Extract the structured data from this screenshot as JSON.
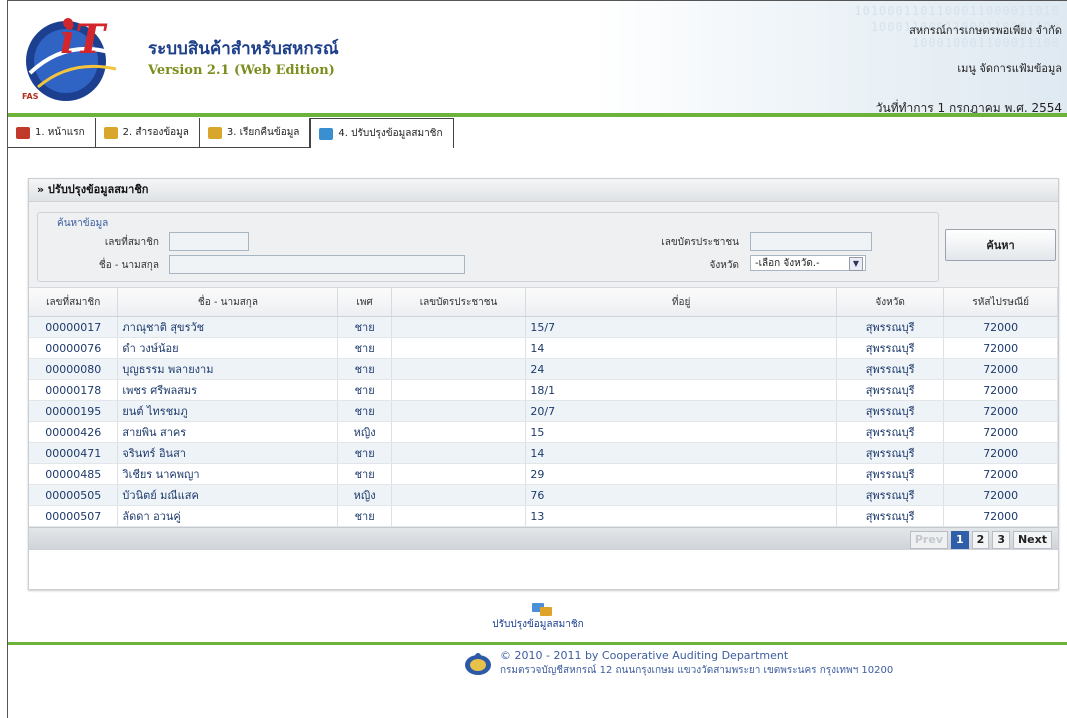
{
  "header": {
    "app_title": "ระบบสินค้าสำหรับสหกรณ์",
    "app_version": "Version 2.1 (Web Edition)",
    "coop_name": "สหกรณ์การเกษตรพอเพียง จำกัด",
    "menu_label": "เมนู จัดการแฟ้มข้อมูล",
    "work_date": "วันที่ทำการ 1 กรกฎาคม พ.ศ. 2554",
    "binary_pattern": [
      "1010001101100011000011010",
      "10001100011000110001100",
      "100010001100011100"
    ]
  },
  "nav": {
    "items": [
      {
        "label": "1. หน้าแรก",
        "icon": "home-icon",
        "color": "#c0392b"
      },
      {
        "label": "2. สำรองข้อมูล",
        "icon": "backup-icon",
        "color": "#d8a62a"
      },
      {
        "label": "3. เรียกคืนข้อมูล",
        "icon": "restore-icon",
        "color": "#d8a62a"
      },
      {
        "label": "4. ปรับปรุงข้อมูลสมาชิก",
        "icon": "update-member-icon",
        "color": "#3a8fd0"
      }
    ]
  },
  "panel": {
    "title": "» ปรับปรุงข้อมูลสมาชิก",
    "search": {
      "legend": "ค้นหาข้อมูล",
      "member_no_label": "เลขที่สมาชิก",
      "member_no_value": "",
      "name_label": "ชื่อ - นามสกุล",
      "name_value": "",
      "citizen_id_label": "เลขบัตรประชาชน",
      "citizen_id_value": "",
      "province_label": "จังหวัด",
      "province_selected": "-เลือก จังหวัด.-",
      "search_button": "ค้นหา"
    },
    "table": {
      "headers": [
        "เลขที่สมาชิก",
        "ชื่อ - นามสกุล",
        "เพศ",
        "เลขบัตรประชาชน",
        "ที่อยู่",
        "จังหวัด",
        "รหัสไปรษณีย์"
      ],
      "rows": [
        [
          "00000017",
          "ภาณุชาติ สุขรวัช",
          "ชาย",
          "",
          "15/7",
          "สุพรรณบุรี",
          "72000"
        ],
        [
          "00000076",
          "ดำ วงษ์น้อย",
          "ชาย",
          "",
          "14",
          "สุพรรณบุรี",
          "72000"
        ],
        [
          "00000080",
          "บุญธรรม พลายงาม",
          "ชาย",
          "",
          "24",
          "สุพรรณบุรี",
          "72000"
        ],
        [
          "00000178",
          "เพชร ศรีพลสมร",
          "ชาย",
          "",
          "18/1",
          "สุพรรณบุรี",
          "72000"
        ],
        [
          "00000195",
          "ยนต์ ไทรชมภู",
          "ชาย",
          "",
          "20/7",
          "สุพรรณบุรี",
          "72000"
        ],
        [
          "00000426",
          "สายพิน สาคร",
          "หญิง",
          "",
          "15",
          "สุพรรณบุรี",
          "72000"
        ],
        [
          "00000471",
          "จรินทร์ อินสา",
          "ชาย",
          "",
          "14",
          "สุพรรณบุรี",
          "72000"
        ],
        [
          "00000485",
          "วิเชียร นาคพญา",
          "ชาย",
          "",
          "29",
          "สุพรรณบุรี",
          "72000"
        ],
        [
          "00000505",
          "บัวนิตย์ มณีแสค",
          "หญิง",
          "",
          "76",
          "สุพรรณบุรี",
          "72000"
        ],
        [
          "00000507",
          "ลัดดา อวนคู่",
          "ชาย",
          "",
          "13",
          "สุพรรณบุรี",
          "72000"
        ]
      ]
    },
    "pager": {
      "prev": "Prev",
      "pages": [
        "1",
        "2",
        "3"
      ],
      "current_page": "1",
      "next": "Next"
    }
  },
  "below_link": "ปรับปรุงข้อมูลสมาชิก",
  "footer": {
    "copyright": "© 2010 - 2011  by Cooperative Auditing Department",
    "address": "กรมตรวจบัญชีสหกรณ์ 12 ถนนกรุงเกษม แขวงวัดสามพระยา เขตพระนคร กรุงเทพฯ 10200"
  },
  "colors": {
    "accent_green": "#6db23b",
    "title_blue": "#1e3f8a",
    "current_page": "#2f5fa8"
  }
}
